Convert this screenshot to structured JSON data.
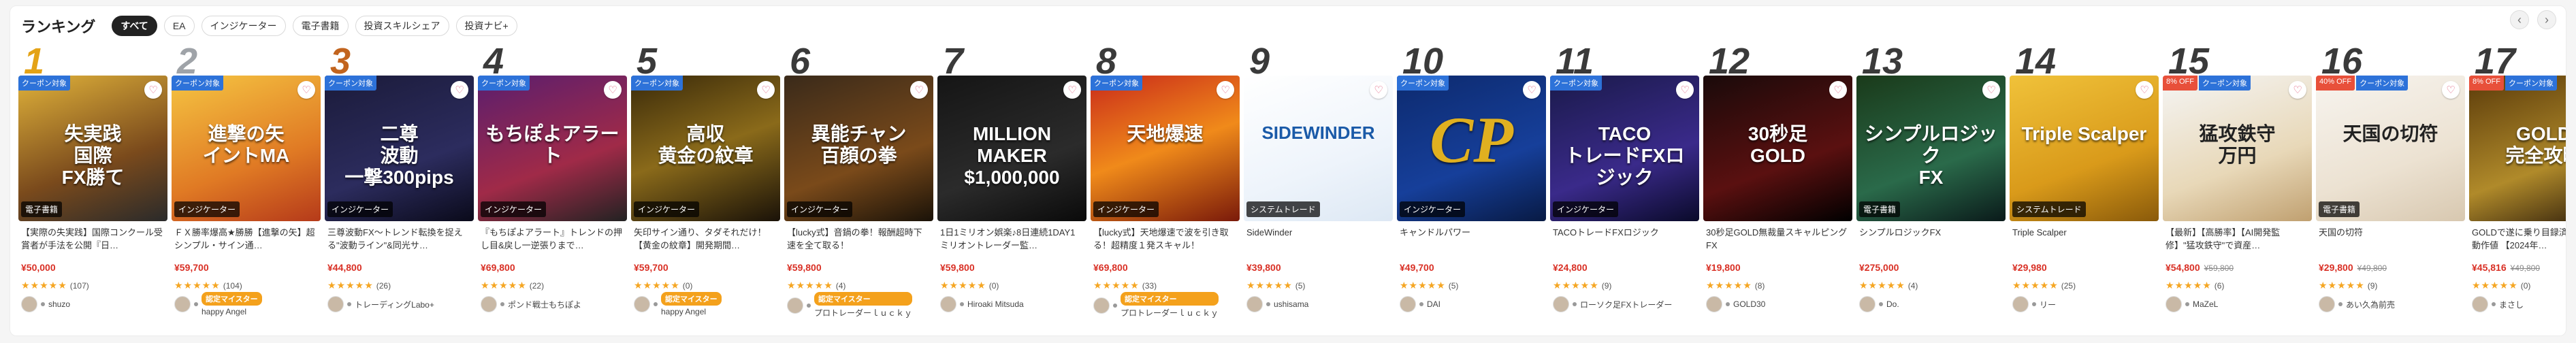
{
  "header": {
    "title": "ランキング",
    "filters": [
      "すべて",
      "EA",
      "インジケーター",
      "電子書籍",
      "投資スキルシェア",
      "投資ナビ+"
    ],
    "active_filter": 0
  },
  "nav": {
    "prev": "‹",
    "next": "›"
  },
  "fav_glyph": "♡",
  "cards": [
    {
      "rank": "1",
      "badges": [
        "クーポン対象"
      ],
      "thumb_text": "失実践\n国際\nFX勝て",
      "category": "電子書籍",
      "bg": "linear-gradient(160deg,#e0b23a,#7a4a1c 60%,#2a2a2a)",
      "desc": "【実際の失実践】国際コンクール受賞者が手法を公開『日…",
      "price": "¥50,000",
      "old_price": "",
      "stars": "★★★★★",
      "reviews": "(107)",
      "seller": "shuzo",
      "master": ""
    },
    {
      "rank": "2",
      "badges": [
        "クーポン対象"
      ],
      "thumb_text": "進撃の矢\nイントMA",
      "category": "インジケーター",
      "bg": "linear-gradient(160deg,#f5c542,#e07a24 60%,#b53a1a)",
      "desc": "ＦＸ勝率爆高★勝勝【進撃の矢】超シンプル・サイン通…",
      "price": "¥59,700",
      "old_price": "",
      "stars": "★★★★★",
      "reviews": "(104)",
      "seller": "happy Angel",
      "master": "認定マイスター"
    },
    {
      "rank": "3",
      "badges": [
        "クーポン対象"
      ],
      "thumb_text": "二尊\n波動\n一撃300pips",
      "category": "インジケーター",
      "bg": "linear-gradient(160deg,#1b1b3a,#2c2c5e 60%,#0a0a1a)",
      "desc": "三尊波動FX～トレンド転換を捉える\"波動ライン\"&同光サ…",
      "price": "¥44,800",
      "old_price": "",
      "stars": "★★★★★",
      "reviews": "(26)",
      "seller": "トレーディングLabo+",
      "master": ""
    },
    {
      "rank": "4",
      "badges": [
        "クーポン対象"
      ],
      "thumb_text": "もちぽよアラート",
      "category": "インジケーター",
      "bg": "linear-gradient(160deg,#5a1e6e,#a02a48 60%,#222)",
      "desc": "『もちぽよアラート』トレンドの押し目&戻し一逆張りまで…",
      "price": "¥69,800",
      "old_price": "",
      "stars": "★★★★★",
      "reviews": "(22)",
      "seller": "ポンド戦士もちぽよ",
      "master": ""
    },
    {
      "rank": "5",
      "badges": [
        "クーポン対象"
      ],
      "thumb_text": "高収\n黄金の紋章",
      "category": "インジケーター",
      "bg": "linear-gradient(160deg,#3a2a0a,#8a6a1a 50%,#1a1208)",
      "desc": "矢印サイン通り、タダそれだけ！【黄金の紋章】開発期間…",
      "price": "¥59,700",
      "old_price": "",
      "stars": "★★★★★",
      "reviews": "(0)",
      "seller": "happy Angel",
      "master": "認定マイスター"
    },
    {
      "rank": "6",
      "badges": [],
      "thumb_text": "異能チャン\n百顔の拳",
      "category": "インジケーター",
      "bg": "linear-gradient(160deg,#3a2a1a,#7a4a1a 60%,#1a1208)",
      "desc": "【lucky式】音鍋の拳！報酬超時下速を全て取る！",
      "price": "¥59,800",
      "old_price": "",
      "stars": "★★★★★",
      "reviews": "(4)",
      "seller": "プロトレーダーｌｕｃｋｙ",
      "master": "認定マイスター"
    },
    {
      "rank": "7",
      "badges": [],
      "thumb_text": "MILLION MAKER\n$1,000,000",
      "category": "",
      "bg": "linear-gradient(160deg,#151515,#2b2b2b 60%,#0a0a0a)",
      "desc": "1日1ミリオン娯楽♪8日連続1DAY1ミリオントレーダー監…",
      "price": "¥59,800",
      "old_price": "",
      "stars": "★★★★★",
      "reviews": "(0)",
      "seller": "Hiroaki Mitsuda",
      "master": ""
    },
    {
      "rank": "8",
      "badges": [
        "クーポン対象"
      ],
      "thumb_text": "天地爆速",
      "category": "インジケーター",
      "bg": "linear-gradient(160deg,#c92a1a,#f08a1a 50%,#7a1a0a)",
      "desc": "【lucky式】天地爆速で波を引き取る！超精度１発スキャル！",
      "price": "¥69,800",
      "old_price": "",
      "stars": "★★★★★",
      "reviews": "(33)",
      "seller": "プロトレーダーｌｕｃｋｙ",
      "master": "認定マイスター"
    },
    {
      "rank": "9",
      "badges": [],
      "thumb_text": "SIDEWINDER",
      "category": "システムトレード",
      "bg": "linear-gradient(160deg,#ffffff,#eef4fb 60%,#dde8f4)",
      "desc": "SideWinder",
      "price": "¥39,800",
      "old_price": "",
      "stars": "★★★★★",
      "reviews": "(5)",
      "seller": "ushisama",
      "master": ""
    },
    {
      "rank": "10",
      "badges": [
        "クーポン対象"
      ],
      "thumb_text": "CP",
      "category": "インジケーター",
      "bg": "linear-gradient(160deg,#0d2a6e,#163f9a 60%,#081a44)",
      "desc": "キャンドルパワー",
      "price": "¥49,700",
      "old_price": "",
      "stars": "★★★★★",
      "reviews": "(5)",
      "seller": "DAI",
      "master": ""
    },
    {
      "rank": "11",
      "badges": [
        "クーポン対象"
      ],
      "thumb_text": "TACO\nトレードFXロジック",
      "category": "インジケーター",
      "bg": "linear-gradient(160deg,#1a1a4a,#3a2a8a 60%,#0a0a2a)",
      "desc": "TACOトレードFXロジック",
      "price": "¥24,800",
      "old_price": "",
      "stars": "★★★★★",
      "reviews": "(9)",
      "seller": "ローソク足FXトレーダー",
      "master": ""
    },
    {
      "rank": "12",
      "badges": [],
      "thumb_text": "30秒足\nGOLD",
      "category": "",
      "bg": "linear-gradient(160deg,#1a0a0a,#5a1010 60%,#000)",
      "desc": "30秒足GOLD無裁量スキャルピングFX",
      "price": "¥19,800",
      "old_price": "",
      "stars": "★★★★★",
      "reviews": "(8)",
      "seller": "GOLD30",
      "master": ""
    },
    {
      "rank": "13",
      "badges": [],
      "thumb_text": "シンプルロジック\nFX",
      "category": "電子書籍",
      "bg": "linear-gradient(160deg,#1a3a1a,#2a6a4a 60%,#0a1a1a)",
      "desc": "シンプルロジックFX",
      "price": "¥275,000",
      "old_price": "",
      "stars": "★★★★★",
      "reviews": "(4)",
      "seller": "Do.",
      "master": ""
    },
    {
      "rank": "14",
      "badges": [],
      "thumb_text": "Triple Scalper",
      "category": "システムトレード",
      "bg": "linear-gradient(160deg,#f0c23a,#d99a1a 60%,#8a5a0a)",
      "desc": "Triple Scalper",
      "price": "¥29,980",
      "old_price": "",
      "stars": "★★★★★",
      "reviews": "(25)",
      "seller": "リー",
      "master": ""
    },
    {
      "rank": "15",
      "badges": [
        "8% OFF",
        "クーポン対象"
      ],
      "thumb_text": "猛攻鉄守\n万円",
      "category": "",
      "bg": "linear-gradient(160deg,#f5f5f5,#e8d8b8 60%,#c0a070)",
      "desc": "【最新】【高勝率】【AI開発監修】\"猛攻鉄守\"で資産…",
      "price": "¥54,800",
      "old_price": "¥59,800",
      "stars": "★★★★★",
      "reviews": "(6)",
      "seller": "MaZeL",
      "master": ""
    },
    {
      "rank": "16",
      "badges": [
        "40% OFF",
        "クーポン対象"
      ],
      "thumb_text": "天国の切符",
      "category": "電子書籍",
      "bg": "linear-gradient(160deg,#f7f4ef,#ece2d2 60%,#d8c8b0)",
      "desc": "天国の切符",
      "price": "¥29,800",
      "old_price": "¥49,800",
      "stars": "★★★★★",
      "reviews": "(9)",
      "seller": "あい久為前売",
      "master": ""
    },
    {
      "rank": "17",
      "badges": [
        "8% OFF",
        "クーポン対象"
      ],
      "thumb_text": "GOLD\n完全攻略",
      "category": "",
      "bg": "linear-gradient(160deg,#5a3a0a,#b08a2a 60%,#2a1a0a)",
      "desc": "GOLDで遂に乗り目録済みのための動作値 【2024年…",
      "price": "¥45,816",
      "old_price": "¥49,800",
      "stars": "★★★★★",
      "reviews": "(0)",
      "seller": "まさし",
      "master": ""
    }
  ]
}
